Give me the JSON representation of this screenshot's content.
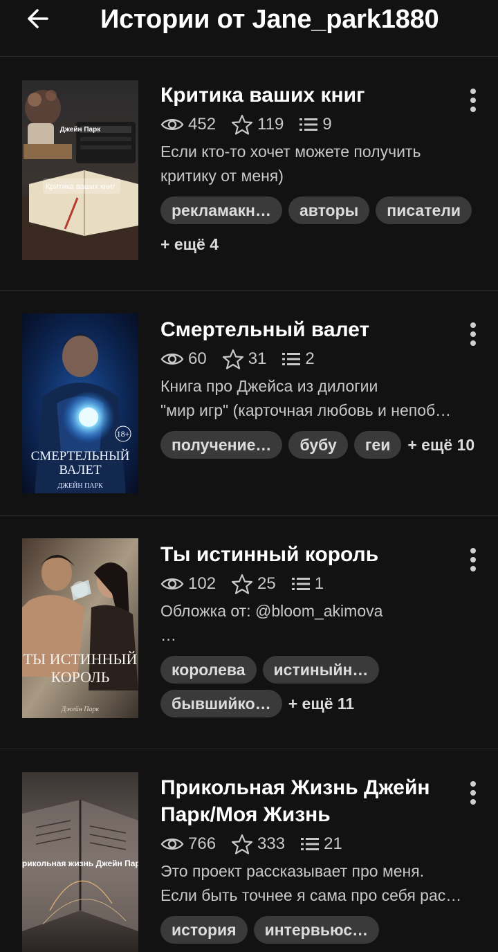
{
  "header": {
    "title": "Истории от Jane_park1880"
  },
  "stories": [
    {
      "title": "Критика ваших книг",
      "views": "452",
      "votes": "119",
      "parts": "9",
      "desc": [
        "Если кто-то хочет можете получить",
        "критику от меня)"
      ],
      "tags": [
        "рекламакн…",
        "авторы",
        "писатели"
      ],
      "more": "+ ещё 4",
      "cover": {
        "author": "Джейн Парк",
        "title": "Критика ваших книг"
      }
    },
    {
      "title": "Смертельный валет",
      "views": "60",
      "votes": "31",
      "parts": "2",
      "desc": [
        "Книга про Джейса из дилогии",
        "\"мир игр\" (карточная любовь и непоб…"
      ],
      "tags": [
        "получение…",
        "бубу",
        "геи"
      ],
      "more": "+ ещё 10",
      "cover": {
        "title1": "СМЕРТЕЛЬНЫЙ",
        "title2": "ВАЛЕТ",
        "author": "ДЖЕЙН ПАРК",
        "rating": "18+"
      }
    },
    {
      "title": "Ты истинный король",
      "views": "102",
      "votes": "25",
      "parts": "1",
      "desc": [
        "Обложка от: @bloom_akimova",
        "…"
      ],
      "tags": [
        "королева",
        "истиныйн…",
        "бывшийко…"
      ],
      "more": "+ ещё 11",
      "cover": {
        "title1": "ТЫ ИСТИННЫЙ",
        "title2": "КОРОЛЬ",
        "author": "Джейн Парк"
      }
    },
    {
      "title": "Прикольная Жизнь Джейн Парк/Моя Жизнь",
      "views": "766",
      "votes": "333",
      "parts": "21",
      "desc": [
        "Это проект рассказывает про меня.",
        "Если быть точнее я сама про себя рас…"
      ],
      "tags": [
        "история",
        "интервьюс…"
      ],
      "more": "",
      "cover": {
        "title": "Прикольная жизнь Джейн Парк"
      }
    }
  ]
}
